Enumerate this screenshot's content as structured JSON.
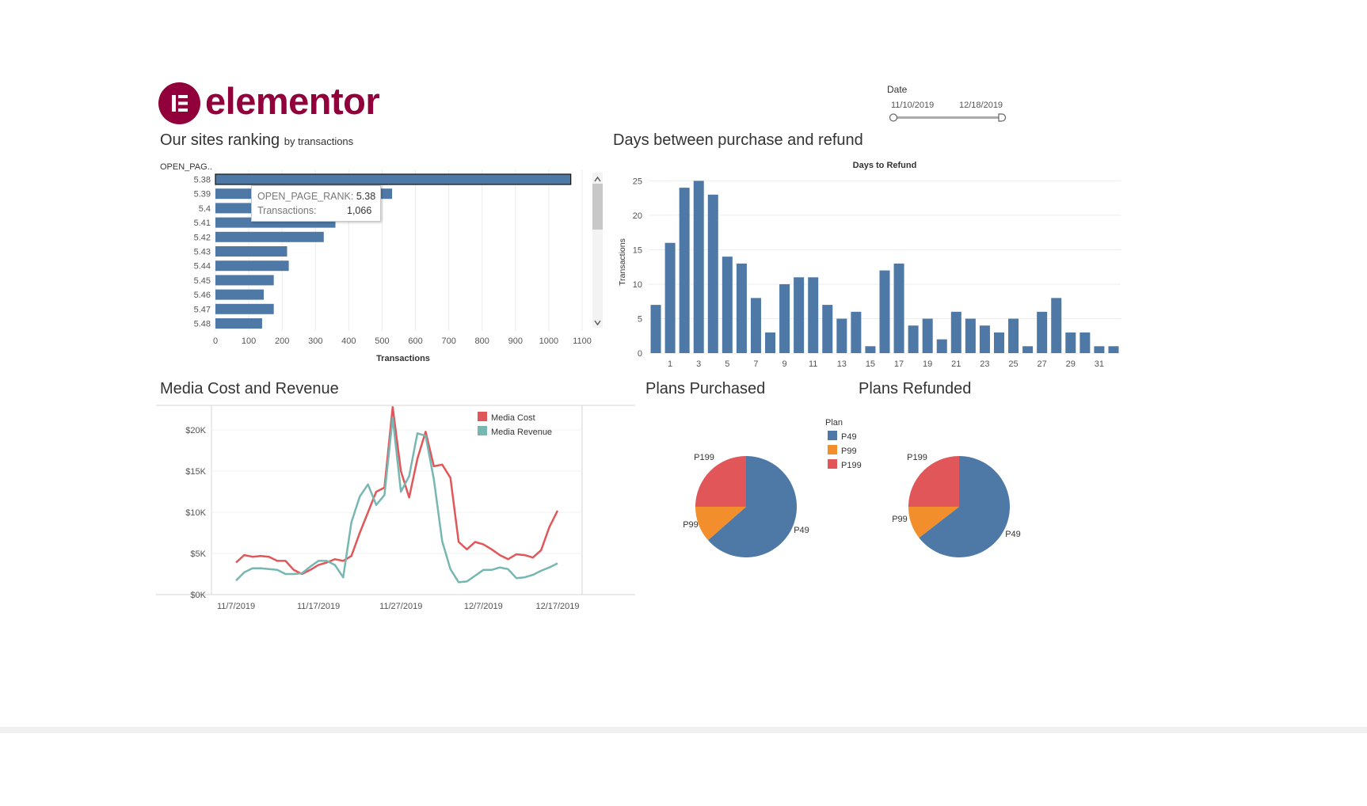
{
  "brand": {
    "name": "elementor",
    "color": "#92003b"
  },
  "filter": {
    "label": "Date",
    "start": "11/10/2019",
    "end": "12/18/2019"
  },
  "tooltip": {
    "rank_label": "OPEN_PAGE_RANK:",
    "rank_value": "5.38",
    "tx_label": "Transactions:",
    "tx_value": "1,066"
  },
  "chart_data": [
    {
      "id": "sites-ranking",
      "type": "bar",
      "orientation": "horizontal",
      "title": "Our sites ranking",
      "subtitle": "by transactions",
      "row_header": "OPEN_PAG..",
      "categories": [
        "5.38",
        "5.39",
        "5.4",
        "5.41",
        "5.42",
        "5.43",
        "5.44",
        "5.45",
        "5.46",
        "5.47",
        "5.48"
      ],
      "values": [
        1066,
        530,
        145,
        360,
        325,
        215,
        220,
        175,
        145,
        175,
        140
      ],
      "xlabel": "Transactions",
      "xticks": [
        0,
        100,
        200,
        300,
        400,
        500,
        600,
        700,
        800,
        900,
        1000,
        1100
      ],
      "xlim": [
        0,
        1100
      ],
      "color": "#4e79a7",
      "grid": true
    },
    {
      "id": "days-to-refund",
      "type": "bar",
      "title": "Days between purchase and refund",
      "subtitle": "Days to Refund",
      "ylabel": "Transactions",
      "x": [
        0,
        1,
        2,
        3,
        4,
        5,
        6,
        7,
        8,
        9,
        10,
        11,
        12,
        13,
        14,
        15,
        16,
        17,
        18,
        19,
        20,
        21,
        22,
        23,
        24,
        25,
        26,
        27,
        28,
        29,
        30,
        31,
        32
      ],
      "values": [
        7,
        16,
        24,
        25,
        23,
        14,
        13,
        8,
        3,
        10,
        11,
        11,
        7,
        5,
        6,
        1,
        12,
        13,
        4,
        5,
        2,
        6,
        5,
        4,
        3,
        5,
        1,
        6,
        8,
        3,
        3,
        1,
        1
      ],
      "xticks": [
        "1",
        "3",
        "5",
        "7",
        "9",
        "11",
        "13",
        "15",
        "17",
        "19",
        "21",
        "23",
        "25",
        "27",
        "29",
        "31"
      ],
      "yticks": [
        0,
        5,
        10,
        15,
        20,
        25
      ],
      "ylim": [
        0,
        27
      ],
      "color": "#4e79a7",
      "grid": true
    },
    {
      "id": "media-cost-revenue",
      "type": "line",
      "title": "Media Cost and Revenue",
      "x_start": "11/7/2019",
      "x_end": "12/17/2019",
      "xticks": [
        "11/7/2019",
        "11/17/2019",
        "11/27/2019",
        "12/7/2019",
        "12/17/2019"
      ],
      "yticks": [
        "$0K",
        "$5K",
        "$10K",
        "$15K",
        "$20K"
      ],
      "ylim": [
        0,
        23000
      ],
      "legend_position": "top-right",
      "series": [
        {
          "name": "Media Cost",
          "color": "#e15759",
          "values": [
            3900,
            4800,
            4600,
            4700,
            4600,
            4100,
            4100,
            3000,
            2500,
            3000,
            3600,
            3900,
            4300,
            4100,
            4700,
            7500,
            10000,
            12500,
            13000,
            22800,
            15000,
            11800,
            16500,
            19800,
            15600,
            15800,
            14200,
            6400,
            5500,
            6400,
            6100,
            5500,
            4800,
            4300,
            4900,
            4800,
            4500,
            5400,
            8200,
            10200
          ]
        },
        {
          "name": "Media Revenue",
          "color": "#76b7b2",
          "values": [
            1700,
            2700,
            3200,
            3200,
            3100,
            3000,
            2500,
            2500,
            2600,
            3400,
            4100,
            4100,
            3600,
            2100,
            8800,
            11900,
            13400,
            10900,
            12100,
            21500,
            12500,
            14400,
            19600,
            19300,
            14000,
            6500,
            3100,
            1500,
            1600,
            2300,
            3000,
            3000,
            3300,
            3100,
            2000,
            2100,
            2400,
            2900,
            3300,
            3800
          ]
        }
      ]
    },
    {
      "id": "plans-purchased",
      "type": "pie",
      "title": "Plans Purchased",
      "slices": [
        {
          "label": "P49",
          "value": 63.5,
          "color": "#4e79a7"
        },
        {
          "label": "P99",
          "value": 11.5,
          "color": "#f28e2b"
        },
        {
          "label": "P199",
          "value": 25.0,
          "color": "#e15759"
        }
      ]
    },
    {
      "id": "plans-refunded",
      "type": "pie",
      "title": "Plans Refunded",
      "slices": [
        {
          "label": "P49",
          "value": 64.5,
          "color": "#4e79a7"
        },
        {
          "label": "P99",
          "value": 10.5,
          "color": "#f28e2b"
        },
        {
          "label": "P199",
          "value": 25.0,
          "color": "#e15759"
        }
      ]
    }
  ],
  "plan_legend": {
    "title": "Plan",
    "items": [
      {
        "label": "P49",
        "color": "#4e79a7"
      },
      {
        "label": "P99",
        "color": "#f28e2b"
      },
      {
        "label": "P199",
        "color": "#e15759"
      }
    ]
  }
}
